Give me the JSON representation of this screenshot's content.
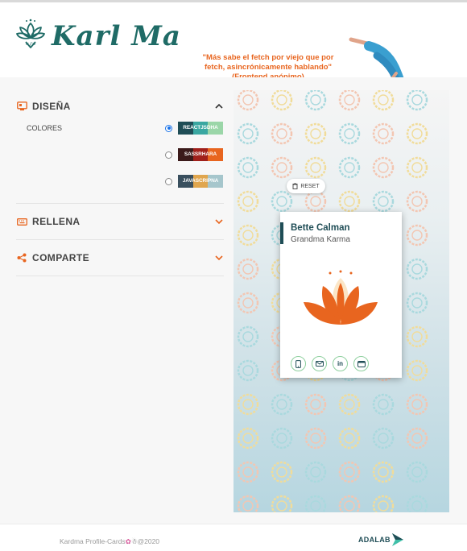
{
  "header": {
    "brand": "Karl Ma",
    "quote": "\"Más sabe el fetch por viejo que por fetch, asincrónicamente hablando\" (Frontend anónimo)"
  },
  "form": {
    "design": {
      "title": "DISEÑA",
      "colors_label": "COLORES",
      "palettes": [
        {
          "name": "REACTJSDHA",
          "selected": true,
          "colors": [
            "#1f4d56",
            "#3aa7a1",
            "#9bd6a8"
          ]
        },
        {
          "name": "SASSRHARA",
          "selected": false,
          "colors": [
            "#3b1a1a",
            "#a0201b",
            "#e8651f"
          ]
        },
        {
          "name": "JAVASCRIPNA",
          "selected": false,
          "colors": [
            "#394f5e",
            "#e0a64e",
            "#a6c6cc"
          ]
        }
      ]
    },
    "fill": {
      "title": "RELLENA"
    },
    "share": {
      "title": "COMPARTE"
    }
  },
  "preview": {
    "reset_label": "RESET",
    "card": {
      "name": "Bette Calman",
      "job": "Grandma Karma",
      "socials": [
        "phone-icon",
        "email-icon",
        "linkedin-icon",
        "github-icon"
      ],
      "linkedin_text": "in"
    }
  },
  "footer": {
    "copyright": "Kardma Profile-Cards",
    "year": "@2020",
    "partner": "ADALAB"
  },
  "colors": {
    "accent": "#e8651f",
    "teal": "#1f6b66",
    "dark": "#1f4d56"
  }
}
